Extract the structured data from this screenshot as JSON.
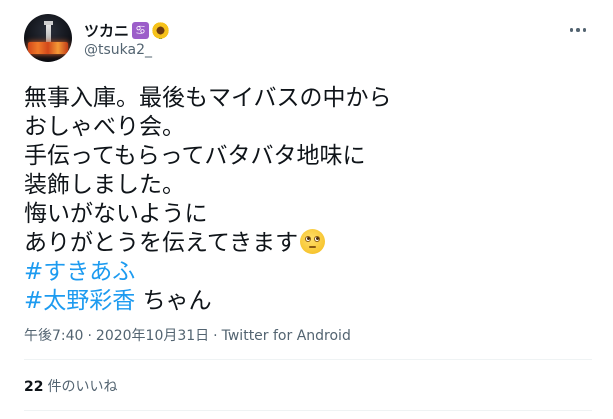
{
  "user": {
    "display_name": "ツカニ",
    "zodiac_emoji": "♋",
    "sunflower_emoji": "🌻",
    "handle": "@tsuka2_"
  },
  "tweet": {
    "lines": [
      "無事入庫。最後もマイバスの中から",
      "おしゃべり会。",
      "手伝ってもらってバタバタ地味に",
      "装飾しました。",
      "悔いがないように",
      "ありがとうを伝えてきます"
    ],
    "emoji": "face-with-rolling-eyes",
    "hashtag_1": "#すきあふ",
    "hashtag_2": "#太野彩香",
    "suffix": " ちゃん"
  },
  "meta": {
    "time": "午後7:40",
    "separator_1": "·",
    "date": "2020年10月31日",
    "separator_2": "·",
    "source": "Twitter for Android"
  },
  "stats": {
    "likes_count": "22",
    "likes_label": "件のいいね"
  },
  "colors": {
    "link": "#1d9bf0",
    "text": "#0f1419",
    "secondary": "#536471",
    "divider": "#eff3f4"
  }
}
